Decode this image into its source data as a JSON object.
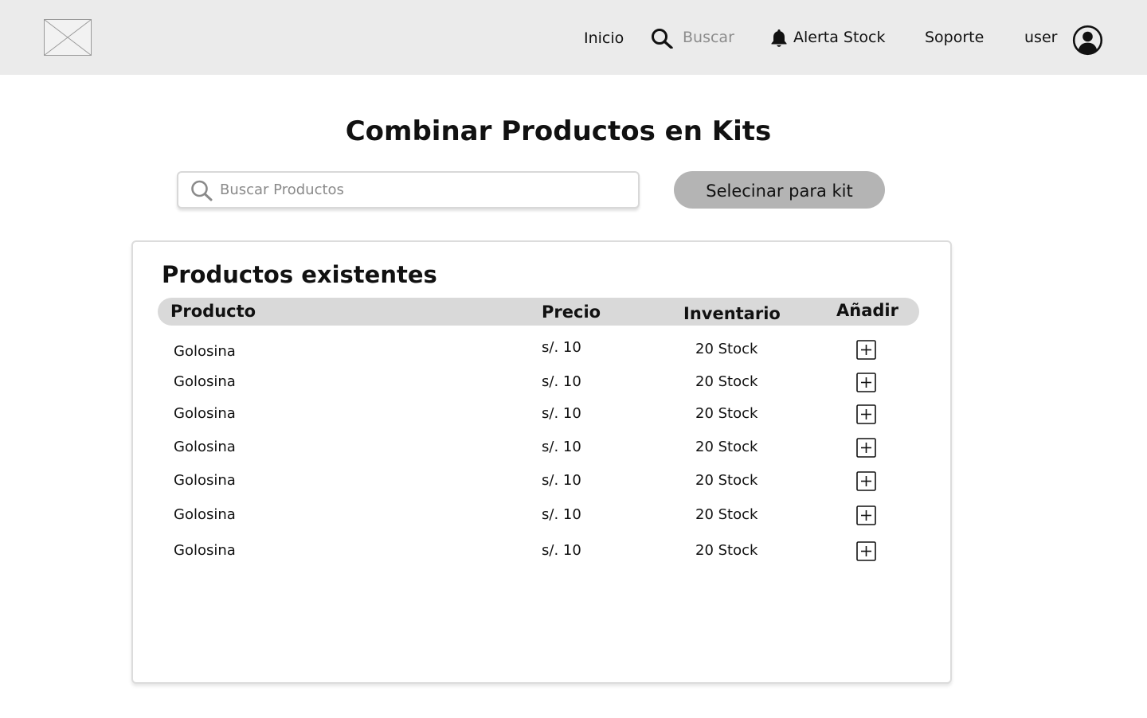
{
  "nav": {
    "inicio": "Inicio",
    "buscar": "Buscar",
    "alerta_stock": "Alerta Stock",
    "soporte": "Soporte",
    "user": "user"
  },
  "page": {
    "title": "Combinar Productos en Kits"
  },
  "search": {
    "placeholder": "Buscar Productos"
  },
  "kit_button": {
    "label": "Selecinar para kit"
  },
  "panel": {
    "title": "Productos existentes",
    "columns": [
      "Producto",
      "Precio",
      "Inventario",
      "Añadir"
    ],
    "rows": [
      {
        "producto": "Golosina",
        "precio": "s/. 10",
        "inventario": "20 Stock"
      },
      {
        "producto": "Golosina",
        "precio": "s/. 10",
        "inventario": "20 Stock"
      },
      {
        "producto": "Golosina",
        "precio": "s/. 10",
        "inventario": "20 Stock"
      },
      {
        "producto": "Golosina",
        "precio": "s/. 10",
        "inventario": "20 Stock"
      },
      {
        "producto": "Golosina",
        "precio": "s/. 10",
        "inventario": "20 Stock"
      },
      {
        "producto": "Golosina",
        "precio": "s/. 10",
        "inventario": "20 Stock"
      },
      {
        "producto": "Golosina",
        "precio": "s/. 10",
        "inventario": "20 Stock"
      }
    ]
  },
  "icons": {
    "logo": "image-placeholder-icon",
    "search": "search-icon",
    "alert": "bell-icon",
    "user": "user-circle-icon",
    "add": "plus-square-icon"
  },
  "colors": {
    "topbar": "#ebebeb",
    "button": "#b4b4b4",
    "table_header": "#d9d9d9",
    "muted_text": "#8a8a8a"
  }
}
